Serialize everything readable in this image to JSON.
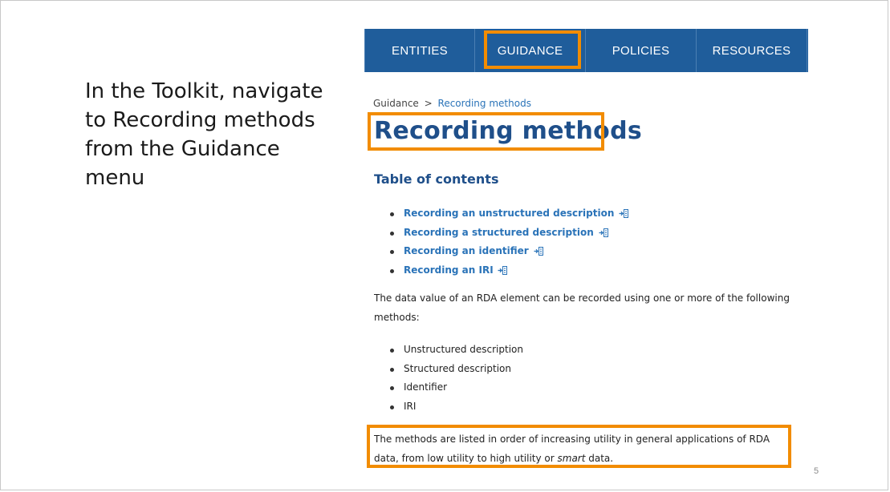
{
  "instruction": {
    "text": "In the Toolkit, navigate to Recording methods from the Guidance menu"
  },
  "nav": {
    "items": [
      {
        "label": "ENTITIES"
      },
      {
        "label": "GUIDANCE",
        "highlighted": true
      },
      {
        "label": "POLICIES"
      },
      {
        "label": "RESOURCES"
      }
    ],
    "background_color": "#1f5d9b"
  },
  "breadcrumb": {
    "parent": "Guidance",
    "separator": ">",
    "current": "Recording methods"
  },
  "page": {
    "title": "Recording methods",
    "toc_heading": "Table of contents",
    "toc_items": [
      {
        "label": "Recording an unstructured description",
        "icon": "jump-to-section-icon"
      },
      {
        "label": "Recording a structured description",
        "icon": "jump-to-section-icon"
      },
      {
        "label": "Recording an identifier",
        "icon": "jump-to-section-icon"
      },
      {
        "label": "Recording an IRI",
        "icon": "jump-to-section-icon"
      }
    ],
    "intro_text": "The data value of an RDA element can be recorded using one or more of the following methods:",
    "methods": [
      "Unstructured description",
      "Structured description",
      "Identifier",
      "IRI"
    ],
    "closing_text_before": "The methods are listed in order of increasing utility in general applications of RDA data, from low utility to high utility or ",
    "closing_text_emphasis": "smart",
    "closing_text_after": " data."
  },
  "highlight_color": "#f28c00",
  "link_color": "#2a73b8",
  "slide_number": "5"
}
